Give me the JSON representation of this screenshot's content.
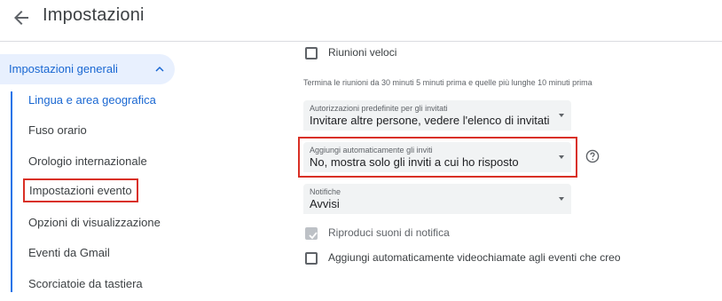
{
  "header": {
    "title": "Impostazioni",
    "back_icon": "arrow-back-icon"
  },
  "sidebar": {
    "group_label": "Impostazioni generali",
    "group_icon": "chevron-up-icon",
    "items": [
      {
        "label": "Lingua e area geografica"
      },
      {
        "label": "Fuso orario"
      },
      {
        "label": "Orologio internazionale"
      },
      {
        "label": "Impostazioni evento"
      },
      {
        "label": "Opzioni di visualizzazione"
      },
      {
        "label": "Eventi da Gmail"
      },
      {
        "label": "Scorciatoie da tastiera"
      }
    ]
  },
  "main": {
    "speedy_meetings": {
      "label": "Riunioni veloci",
      "checked": false
    },
    "speedy_hint": "Termina le riunioni da 30 minuti 5 minuti prima e quelle più lunghe 10 minuti prima",
    "guest_permissions": {
      "label": "Autorizzazioni predefinite per gli invitati",
      "value": "Invitare altre persone, vedere l'elenco di invitati"
    },
    "auto_invites": {
      "label": "Aggiungi automaticamente gli inviti",
      "value": "No, mostra solo gli inviti a cui ho risposto"
    },
    "notifications": {
      "label": "Notifiche",
      "value": "Avvisi"
    },
    "sounds": {
      "label": "Riproduci suoni di notifica",
      "checked": true
    },
    "video_calls": {
      "label": "Aggiungi automaticamente videochiamate agli eventi che creo",
      "checked": false
    },
    "help_icon": "help-circle-icon"
  },
  "colors": {
    "accent": "#1a73e8",
    "highlight": "#d93025",
    "active_bg": "#e8f0fe"
  }
}
